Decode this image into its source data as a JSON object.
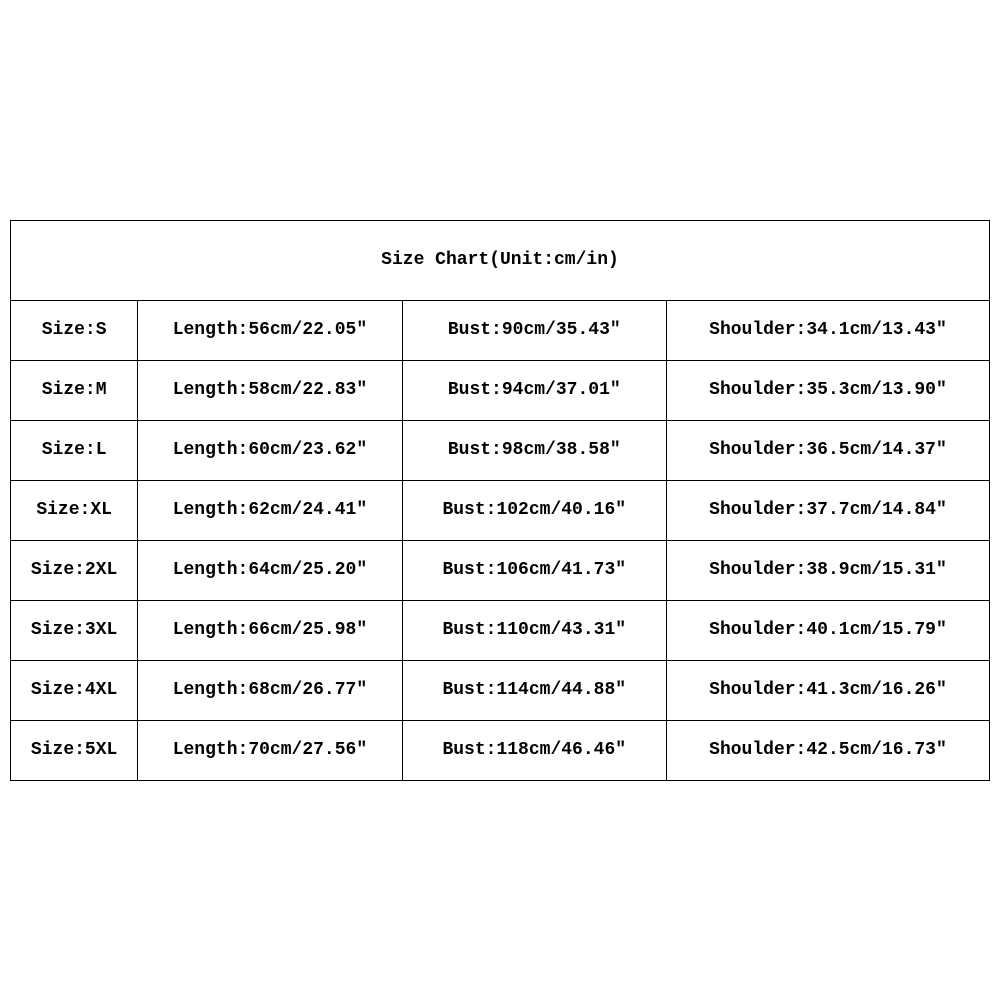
{
  "title": "Size Chart(Unit:cm/in)",
  "rows": [
    {
      "size": "Size:S",
      "length": "Length:56cm/22.05″",
      "bust": "Bust:90cm/35.43″",
      "shoulder": "Shoulder:34.1cm/13.43″"
    },
    {
      "size": "Size:M",
      "length": "Length:58cm/22.83″",
      "bust": "Bust:94cm/37.01″",
      "shoulder": "Shoulder:35.3cm/13.90″"
    },
    {
      "size": "Size:L",
      "length": "Length:60cm/23.62″",
      "bust": "Bust:98cm/38.58″",
      "shoulder": "Shoulder:36.5cm/14.37″"
    },
    {
      "size": "Size:XL",
      "length": "Length:62cm/24.41″",
      "bust": "Bust:102cm/40.16″",
      "shoulder": "Shoulder:37.7cm/14.84″"
    },
    {
      "size": "Size:2XL",
      "length": "Length:64cm/25.20″",
      "bust": "Bust:106cm/41.73″",
      "shoulder": "Shoulder:38.9cm/15.31″"
    },
    {
      "size": "Size:3XL",
      "length": "Length:66cm/25.98″",
      "bust": "Bust:110cm/43.31″",
      "shoulder": "Shoulder:40.1cm/15.79″"
    },
    {
      "size": "Size:4XL",
      "length": "Length:68cm/26.77″",
      "bust": "Bust:114cm/44.88″",
      "shoulder": "Shoulder:41.3cm/16.26″"
    },
    {
      "size": "Size:5XL",
      "length": "Length:70cm/27.56″",
      "bust": "Bust:118cm/46.46″",
      "shoulder": "Shoulder:42.5cm/16.73″"
    }
  ],
  "chart_data": {
    "type": "table",
    "title": "Size Chart(Unit:cm/in)",
    "columns": [
      "Size",
      "Length_cm",
      "Length_in",
      "Bust_cm",
      "Bust_in",
      "Shoulder_cm",
      "Shoulder_in"
    ],
    "rows": [
      [
        "S",
        56,
        22.05,
        90,
        35.43,
        34.1,
        13.43
      ],
      [
        "M",
        58,
        22.83,
        94,
        37.01,
        35.3,
        13.9
      ],
      [
        "L",
        60,
        23.62,
        98,
        38.58,
        36.5,
        14.37
      ],
      [
        "XL",
        62,
        24.41,
        102,
        40.16,
        37.7,
        14.84
      ],
      [
        "2XL",
        64,
        25.2,
        106,
        41.73,
        38.9,
        15.31
      ],
      [
        "3XL",
        66,
        25.98,
        110,
        43.31,
        40.1,
        15.79
      ],
      [
        "4XL",
        68,
        26.77,
        114,
        44.88,
        41.3,
        16.26
      ],
      [
        "5XL",
        70,
        27.56,
        118,
        46.46,
        42.5,
        16.73
      ]
    ]
  }
}
